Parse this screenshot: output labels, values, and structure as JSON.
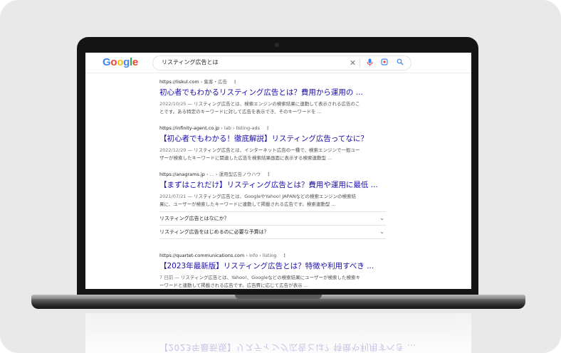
{
  "search": {
    "logo": [
      "G",
      "o",
      "o",
      "g",
      "l",
      "e"
    ],
    "query": "リスティング広告とは",
    "icons": {
      "clear": "close-icon",
      "mic": "mic-icon",
      "lens": "lens-icon",
      "search": "search-icon"
    }
  },
  "results": [
    {
      "url": "https://liskul.com",
      "crumb": "› 集客・広告",
      "title": "初心者でもわかるリスティング広告とは？費用から運用の ...",
      "date": "2022/10/25",
      "snippet_1": " — リスティング広告とは、検索エンジンの検索結果に連動して表示される広告のこ",
      "snippet_2": "とです。ある特定のキーワードに対して広告を表示でき、そのキーワードを ..."
    },
    {
      "url": "https://infinity-agent.co.jp",
      "crumb": "› lab › listing-ads",
      "title": "【初心者でもわかる！徹底解説】リスティング広告ってなに？",
      "date": "2022/12/20",
      "snippet_1": " — リスティング広告とは、インターネット広告の一種で、検索エンジンで一般ユー",
      "snippet_2": "ザーが検索したキーワードに関連した広告を検索結果画面に表示する検索連動型 ..."
    },
    {
      "url": "https://anagrams.jp",
      "crumb": "› ... › 運用型広告ノウハウ",
      "title": "【まずはこれだけ】リスティング広告とは？費用や運用に最低 ...",
      "date": "2021/07/21",
      "snippet_1": " — リスティング広告とは、GoogleやYahoo! JAPANなどの検索エンジンの検索結",
      "snippet_2": "果に、ユーザーが検索したキーワードに連動して掲載される広告です。検索連動型 ...",
      "faq": [
        "リスティング広告とはなにか？",
        "リスティング広告をはじめるのに必要な予算は？"
      ]
    },
    {
      "url": "https://quartet-communications.com",
      "crumb": "› info › listing",
      "title": "【2023年最新版】リスティング広告とは？特徴や利用すべき ...",
      "date": "7 日前",
      "snippet_1": " — リスティング広告とは、Yahoo!、Googleなどの検索結果にユーザーが検索した検索キ",
      "snippet_2": "ーワードと連動して掲載される広告です。広告費に応じて広告が表示 ..."
    }
  ],
  "reflection": "【2023年最新版】リスティング広告とは？特徴や利用すべき ..."
}
